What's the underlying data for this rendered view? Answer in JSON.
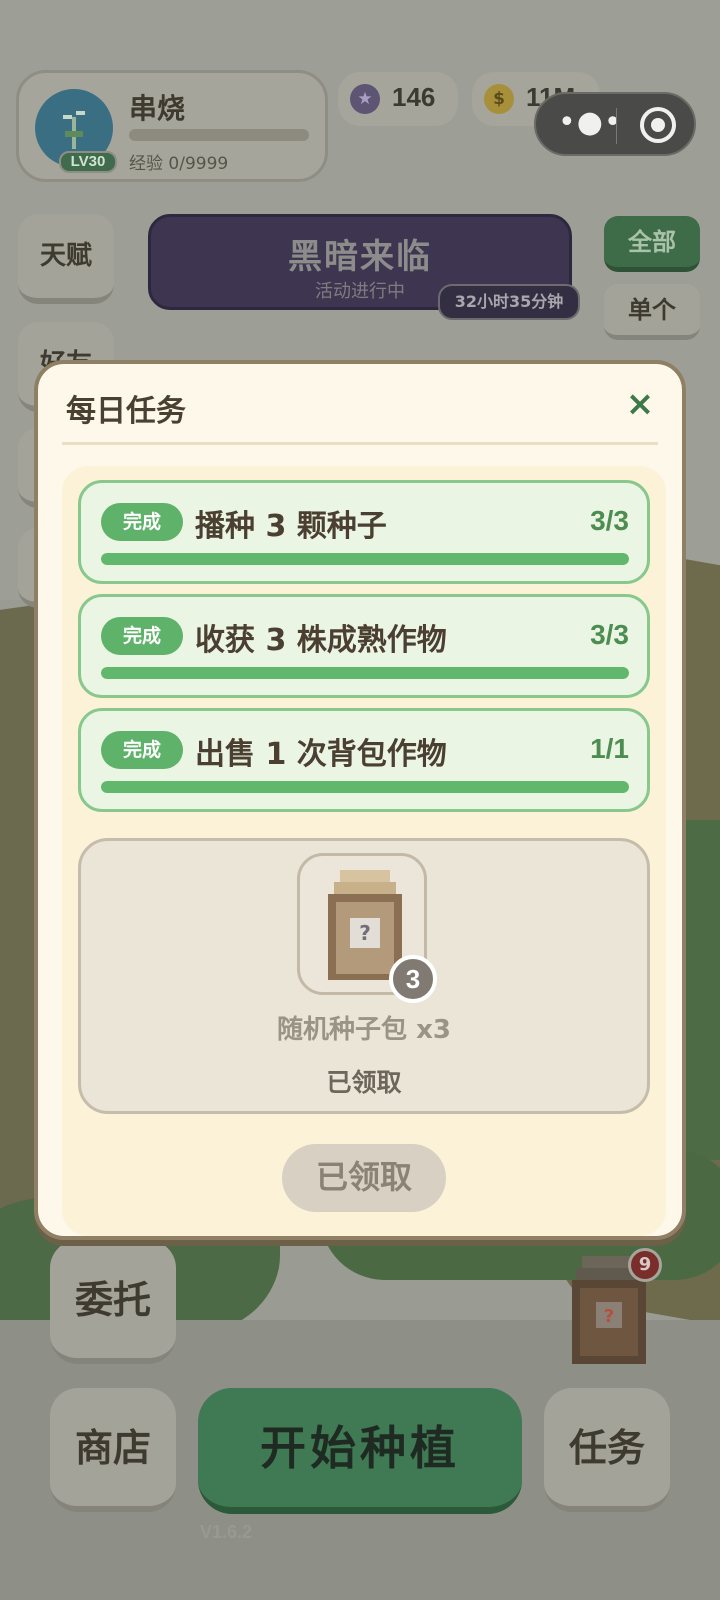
{
  "player": {
    "name": "串烧",
    "level": "LV30",
    "exp_text": "经验 0/9999"
  },
  "currency": {
    "gems": "146",
    "coins": "11M"
  },
  "capsule": {
    "more_icon": "more-dots-icon",
    "close_icon": "target-icon"
  },
  "side_buttons": {
    "talent": "天赋",
    "friend": "好友"
  },
  "event": {
    "title": "黑暗来临",
    "subtitle": "活动进行中",
    "timer": "32小时35分钟"
  },
  "filters": {
    "all": "全部",
    "single": "单个"
  },
  "bottom": {
    "entrust": "委托",
    "shop": "商店",
    "start_planting": "开始种植",
    "tasks": "任务",
    "version": "V1.6.2",
    "crate_badge": "9"
  },
  "modal": {
    "title": "每日任务",
    "close": "×",
    "tasks": [
      {
        "badge": "完成",
        "name": "播种 3 颗种子",
        "count": "3/3",
        "progress": 1.0
      },
      {
        "badge": "完成",
        "name": "收获 3 株成熟作物",
        "count": "3/3",
        "progress": 1.0
      },
      {
        "badge": "完成",
        "name": "出售 1 次背包作物",
        "count": "1/1",
        "progress": 1.0
      }
    ],
    "reward": {
      "quantity_badge": "3",
      "name": "随机种子包 x3",
      "status": "已领取"
    },
    "claim_button": "已领取"
  },
  "colors": {
    "accent_green": "#61b76b",
    "modal_bg": "#fdf8e9",
    "event_purple": "#3e3651"
  }
}
